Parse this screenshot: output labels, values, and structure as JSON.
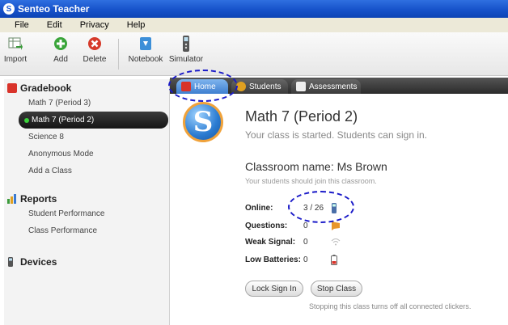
{
  "window": {
    "title": "Senteo Teacher"
  },
  "menu": [
    "File",
    "Edit",
    "Privacy",
    "Help"
  ],
  "toolbar": {
    "import": "Import",
    "add": "Add",
    "delete": "Delete",
    "notebook": "Notebook",
    "simulator": "Simulator"
  },
  "sidebar": {
    "gradebook": {
      "title": "Gradebook",
      "items": [
        "Math 7 (Period 3)",
        "Math 7 (Period 2)",
        "Science 8",
        "Anonymous Mode",
        "Add a Class"
      ]
    },
    "reports": {
      "title": "Reports",
      "items": [
        "Student Performance",
        "Class Performance"
      ]
    },
    "devices": {
      "title": "Devices"
    }
  },
  "tabs": [
    "Home",
    "Students",
    "Assessments"
  ],
  "main": {
    "class_title": "Math 7 (Period 2)",
    "class_status": "Your class is started. Students can sign in.",
    "classroom_name": "Classroom name: Ms Brown",
    "classroom_hint": "Your students should join this classroom.",
    "stats": {
      "online_label": "Online:",
      "online_value": "3 / 26",
      "questions_label": "Questions:",
      "questions_value": "0",
      "weak_label": "Weak Signal:",
      "weak_value": "0",
      "low_label": "Low Batteries:",
      "low_value": "0"
    },
    "lock_button": "Lock Sign In",
    "stop_button": "Stop Class",
    "footnote": "Stopping this class turns off all connected clickers."
  },
  "colors": {
    "title_bar": "#1550c8",
    "selected_item": "#1a1a1a",
    "annotation": "#1a1ac8"
  }
}
